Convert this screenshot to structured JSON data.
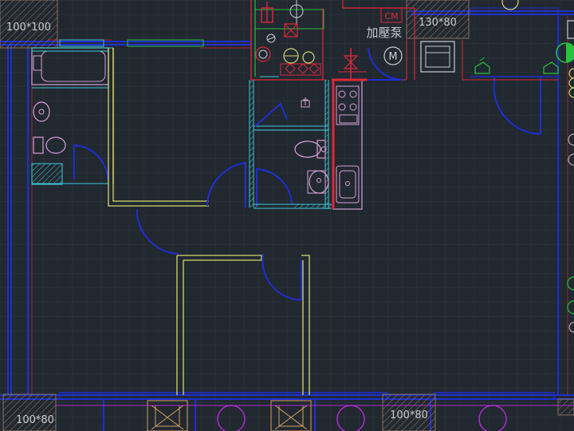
{
  "labels": {
    "column_tl": "100*100",
    "column_tr": "130*80",
    "column_bl": "100*80",
    "column_bm": "100*80",
    "pump": "加壓泵",
    "meter": "M",
    "cm": "CM"
  },
  "colors": {
    "background": "#212830",
    "grid": "#2c3540",
    "wall_blue": "#1f2fd0",
    "cyan": "#3fc8d8",
    "yellow": "#d6d86a",
    "red": "#e0283a",
    "fixture": "#d8a0d8",
    "green": "#27c23a",
    "magenta": "#b02ad0",
    "text": "#c8ccd2",
    "hatch": "#8a7060"
  }
}
